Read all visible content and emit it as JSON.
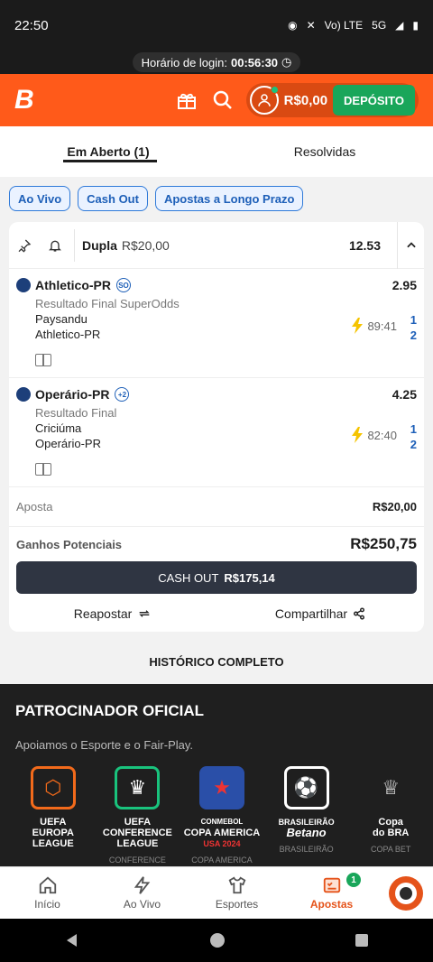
{
  "status": {
    "time": "22:50",
    "network": "Vo) LTE",
    "signal": "5G"
  },
  "login": {
    "label": "Horário de login:",
    "time": "00:56:30"
  },
  "header": {
    "balance": "R$0,00",
    "deposit_label": "DEPÓSITO",
    "brand_color": "#ff5a1a"
  },
  "tabs": [
    {
      "label": "Em Aberto (1)"
    },
    {
      "label": "Resolvidas"
    }
  ],
  "filters": [
    {
      "label": "Ao Vivo"
    },
    {
      "label": "Cash Out"
    },
    {
      "label": "Apostas a Longo Prazo"
    }
  ],
  "bet": {
    "type": "Dupla",
    "stake_inline": "R$20,00",
    "total_odds": "12.53",
    "selections": [
      {
        "team": "Athletico-PR",
        "badge": "SO",
        "odds": "2.95",
        "market": "Resultado Final SuperOdds",
        "home": "Paysandu",
        "away": "Athletico-PR",
        "clock": "89:41",
        "score_home": "1",
        "score_away": "2"
      },
      {
        "team": "Operário-PR",
        "badge": "+2",
        "odds": "4.25",
        "market": "Resultado Final",
        "home": "Criciúma",
        "away": "Operário-PR",
        "clock": "82:40",
        "score_home": "1",
        "score_away": "2"
      }
    ],
    "stake_label": "Aposta",
    "stake_value": "R$20,00",
    "potential_label": "Ganhos Potenciais",
    "potential_value": "R$250,75",
    "cashout_label": "CASH OUT",
    "cashout_value": "R$175,14",
    "repost_label": "Reapostar",
    "share_label": "Compartilhar"
  },
  "historico": "HISTÓRICO COMPLETO",
  "sponsor": {
    "title": "PATROCINADOR OFICIAL",
    "subtitle": "Apoiamos o Esporte e o Fair-Play.",
    "leagues": [
      {
        "line1": "UEFA",
        "line2": "EUROPA",
        "line3": "LEAGUE",
        "sub": ""
      },
      {
        "line1": "UEFA",
        "line2": "CONFERENCE",
        "line3": "LEAGUE",
        "sub": "CONFERENCE"
      },
      {
        "line1": "CONMEBOL",
        "line2": "COPA AMERICA",
        "line3": "USA 2024",
        "sub": "COPA AMERICA"
      },
      {
        "line1": "",
        "line2": "BRASILEIRÃO",
        "line3": "Betano",
        "sub": "BRASILEIRÃO"
      },
      {
        "line1": "Copa",
        "line2": "do BRA",
        "line3": "",
        "sub": "COPA BET"
      }
    ]
  },
  "bottomnav": [
    {
      "label": "Início",
      "icon": "home-icon"
    },
    {
      "label": "Ao Vivo",
      "icon": "lightning-icon"
    },
    {
      "label": "Esportes",
      "icon": "shirt-icon"
    },
    {
      "label": "Apostas",
      "icon": "betslip-icon",
      "badge": "1"
    }
  ]
}
